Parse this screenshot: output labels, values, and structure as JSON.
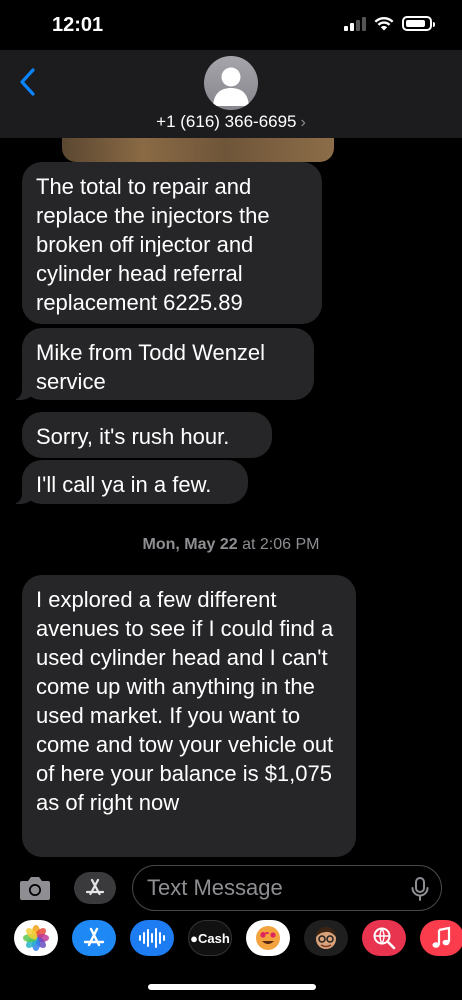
{
  "status_bar": {
    "time": "12:01",
    "signal_bars": 2,
    "battery_level": 0.85,
    "icons": [
      "signal-icon",
      "wifi-icon",
      "battery-icon"
    ]
  },
  "header": {
    "back_icon": "chevron-left-icon",
    "contact_name": "+1 (616) 366-6695",
    "contact_chevron": "›",
    "accent_color": "#0a84ff"
  },
  "messages": [
    {
      "text": "The total to repair and replace the injectors the broken off injector and cylinder head referral replacement 6225.89",
      "direction": "incoming"
    },
    {
      "text": "Mike from Todd Wenzel service",
      "direction": "incoming"
    },
    {
      "text": "Sorry, it's rush hour.",
      "direction": "incoming"
    },
    {
      "text": "I'll call ya in a few.",
      "direction": "incoming"
    }
  ],
  "timestamp": {
    "day": "Mon, May 22",
    "time": "at 2:06 PM"
  },
  "messages_after": [
    {
      "text": "I explored a few different avenues to see if I could find a used cylinder head and I can't come up with anything in the used market. If you want to come and tow your vehicle out of here your balance is $1,075 as of right now",
      "direction": "incoming"
    }
  ],
  "input_bar": {
    "camera_icon": "camera-icon",
    "apps_icon": "app-store-icon",
    "placeholder": "Text Message",
    "mic_icon": "microphone-icon"
  },
  "app_strip": [
    {
      "name": "photos-app-icon",
      "label": ""
    },
    {
      "name": "app-store-app-icon",
      "label": ""
    },
    {
      "name": "audio-message-app-icon",
      "label": ""
    },
    {
      "name": "apple-cash-app-icon",
      "label": "Cash"
    },
    {
      "name": "memoji-stickers-app-icon",
      "label": ""
    },
    {
      "name": "memoji-app-icon",
      "label": ""
    },
    {
      "name": "web-search-app-icon",
      "label": ""
    },
    {
      "name": "music-app-icon",
      "label": ""
    }
  ],
  "colors": {
    "background": "#000000",
    "header_bg": "#1c1c1e",
    "bubble_incoming": "#262628",
    "secondary_text": "#8e8e93"
  }
}
